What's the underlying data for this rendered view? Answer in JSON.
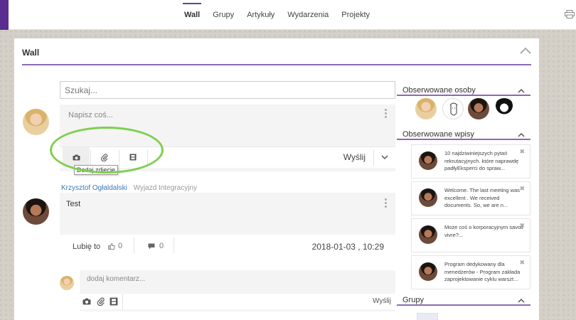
{
  "nav": {
    "tabs": [
      {
        "label": "Wall",
        "active": true
      },
      {
        "label": "Grupy"
      },
      {
        "label": "Artykuły"
      },
      {
        "label": "Wydarzenia"
      },
      {
        "label": "Projekty"
      }
    ]
  },
  "panel": {
    "title": "Wall"
  },
  "search": {
    "placeholder": "Szukaj..."
  },
  "composer": {
    "placeholder": "Napisz coś...",
    "send_label": "Wyślij",
    "tooltip": "Dodaj zdjęcie"
  },
  "post": {
    "author": "Krzysztof Ogłaldalski",
    "event": "Wyjazd Integracyjny",
    "text": "Test",
    "like_label": "Lubię to",
    "like_count": "0",
    "comment_count": "0",
    "date": "2018-01-03 , 10:29"
  },
  "comment": {
    "placeholder": "dodaj komentarz...",
    "send_label": "Wyślij"
  },
  "sidebar": {
    "followed_people_title": "Obserwowane osoby",
    "followed_posts_title": "Obserwowane wpisy",
    "groups_title": "Grupy",
    "followed_posts": [
      {
        "text": "10 najdziwiniejszych pytań rekrutacyjnych. które naprawdę padłyEksperci do spraw..."
      },
      {
        "text": "Welcome. The last meeting was excellent . We received documents. So, we are n..."
      },
      {
        "text": "Może coś o korporacyjnym savoir vivre?..."
      },
      {
        "text": "Program dedykowany dla menedżerów - Program zakłada zaprojektowanie cyklu warszt..."
      }
    ],
    "close_glyph": "✖"
  },
  "colors": {
    "accent": "#6a3ea1",
    "link": "#3c78b8",
    "highlight": "#7fcf4f"
  }
}
